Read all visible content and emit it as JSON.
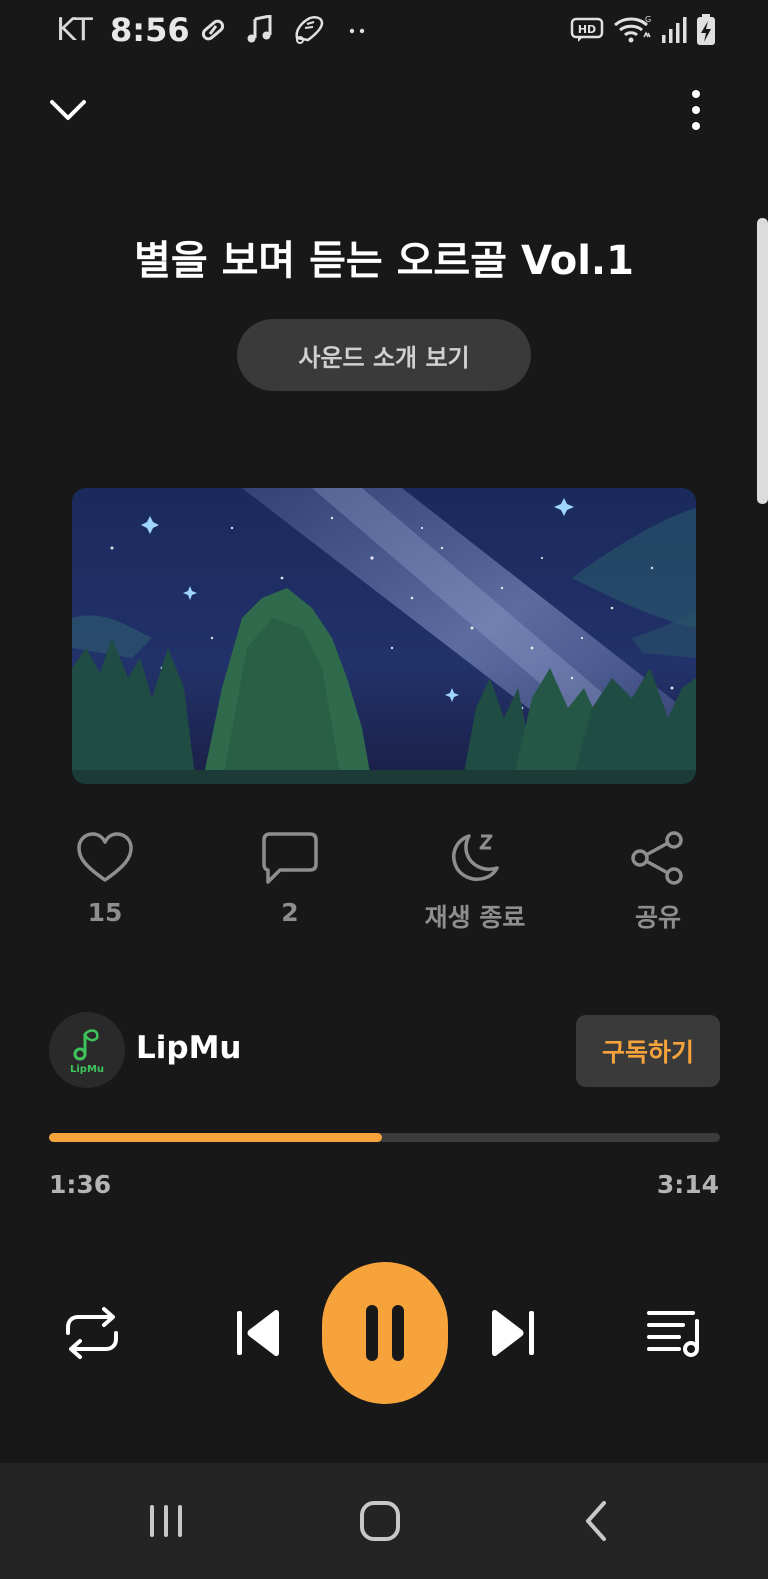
{
  "status_bar": {
    "carrier": "KT",
    "time": "8:56",
    "left_icons": [
      "pill-icon",
      "music-note-icon",
      "shoe-icon",
      "more-dots-icon"
    ],
    "right_icons": [
      "hd-voice-icon",
      "wifi-icon",
      "signal-icon",
      "battery-charging-icon"
    ]
  },
  "header": {
    "title": "별을 보며 듣는 오르골 Vol.1",
    "intro_button": "사운드 소개 보기"
  },
  "artwork": {
    "description_icon": "night-sky-artwork"
  },
  "actions": [
    {
      "icon": "heart-icon",
      "label": "15"
    },
    {
      "icon": "comment-icon",
      "label": "2"
    },
    {
      "icon": "sleep-timer-icon",
      "label": "재생 종료"
    },
    {
      "icon": "share-icon",
      "label": "공유"
    }
  ],
  "channel": {
    "name": "LipMu",
    "avatar_text": "LipMu",
    "subscribe_label": "구독하기"
  },
  "progress": {
    "current": "1:36",
    "total": "3:14",
    "fraction": 0.497
  },
  "colors": {
    "accent": "#f6a33c",
    "background": "#181818",
    "button_bg": "#3a3a3a",
    "nav_bg": "#242424"
  }
}
